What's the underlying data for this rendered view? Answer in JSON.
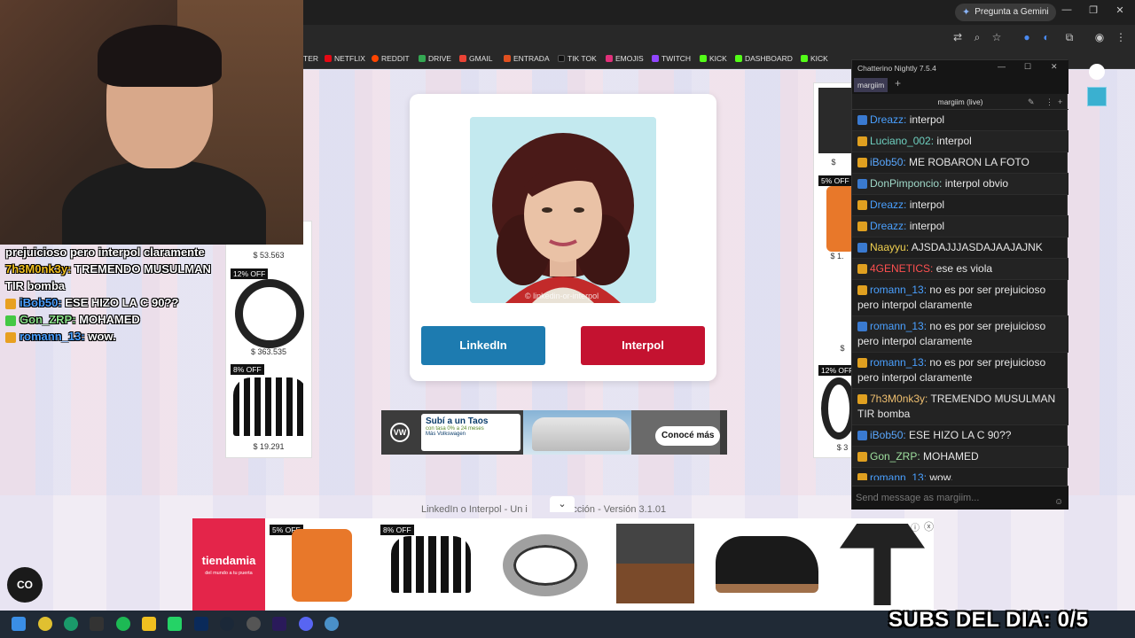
{
  "browser": {
    "gemini_label": "Pregunta a Gemini",
    "bookmarks": [
      "TER",
      "NETFLIX",
      "REDDIT",
      "DRIVE",
      "GMAIL",
      "ENTRADA",
      "TIK TOK",
      "EMOJIS",
      "TWITCH",
      "KICK",
      "DASHBOARD",
      "KICK"
    ]
  },
  "quiz": {
    "watermark": "© linkedin-or-interpol",
    "linkedin_label": "LinkedIn",
    "interpol_label": "Interpol",
    "footer": "LinkedIn o Interpol - Un i",
    "footer_tail": "deducción - Versión 3.1.01"
  },
  "ad_banner": {
    "headline": "Subí a un Taos",
    "sub": "con tasa 0% a 24 meses",
    "brand": "Más Volkswagen",
    "cta": "Conocé más"
  },
  "side_left": {
    "prices": [
      "$ 53.563",
      "$ 363.535",
      "$ 19.291"
    ],
    "tags": [
      "12% OFF",
      "8% OFF"
    ]
  },
  "side_right": {
    "tags": [
      "5% OFF",
      "12% OFF"
    ],
    "fragments": [
      "$",
      "$ 1.",
      "$",
      "$ 3"
    ]
  },
  "bottom_ad": {
    "brand": "tiendamia",
    "brand_sub": "del mundo a tu puerta",
    "tags": [
      "5% OFF",
      "8% OFF"
    ]
  },
  "overlay_chat": [
    {
      "user": "",
      "text": "prejuicioso pero interpol claramente"
    },
    {
      "user": "7h3M0nk3y:",
      "text": "TREMENDO MUSULMAN TIR bomba"
    },
    {
      "user": "iBob50:",
      "text": "ESE HIZO LA C 90??"
    },
    {
      "user": "Gon_ZRP:",
      "text": "MOHAMED"
    },
    {
      "user": "romann_13:",
      "text": "wow."
    }
  ],
  "chatterino": {
    "title": "Chatterino Nightly 7.5.4",
    "tab": "margiim",
    "channel": "margiim (live)",
    "input_placeholder": "Send message as margiim...",
    "messages": [
      {
        "user": "Dreazz:",
        "text": "interpol",
        "color": "#4aa0ff"
      },
      {
        "user": "Luciano_002:",
        "text": "interpol",
        "color": "#6fd0c0"
      },
      {
        "user": "iBob50:",
        "text": "ME ROBARON LA FOTO",
        "color": "#5aa8ff"
      },
      {
        "user": "DonPimponcio:",
        "text": "interpol obvio",
        "color": "#9fd8c8"
      },
      {
        "user": "Dreazz:",
        "text": "interpol",
        "color": "#4aa0ff"
      },
      {
        "user": "Dreazz:",
        "text": "interpol",
        "color": "#4aa0ff"
      },
      {
        "user": "Naayyu:",
        "text": "AJSDAJJJASDAJAAJAJNK",
        "color": "#f0d050"
      },
      {
        "user": "4GENETICS:",
        "text": "ese es viola",
        "color": "#ff5050"
      },
      {
        "user": "romann_13:",
        "text": "no es por ser prejuicioso pero interpol claramente",
        "color": "#4aa0ff"
      },
      {
        "user": "romann_13:",
        "text": "no es por ser prejuicioso pero interpol claramente",
        "color": "#4aa0ff"
      },
      {
        "user": "romann_13:",
        "text": "no es por ser prejuicioso pero interpol claramente",
        "color": "#4aa0ff"
      },
      {
        "user": "7h3M0nk3y:",
        "text": "TREMENDO MUSULMAN TIR bomba",
        "color": "#f0c070"
      },
      {
        "user": "iBob50:",
        "text": "ESE HIZO LA C 90??",
        "color": "#5aa8ff"
      },
      {
        "user": "Gon_ZRP:",
        "text": "MOHAMED",
        "color": "#9fe09f"
      },
      {
        "user": "romann_13:",
        "text": "wow.",
        "color": "#4aa0ff"
      }
    ]
  },
  "stream": {
    "subs": "SUBS DEL DIA: 0/5",
    "co_label": "CO"
  }
}
